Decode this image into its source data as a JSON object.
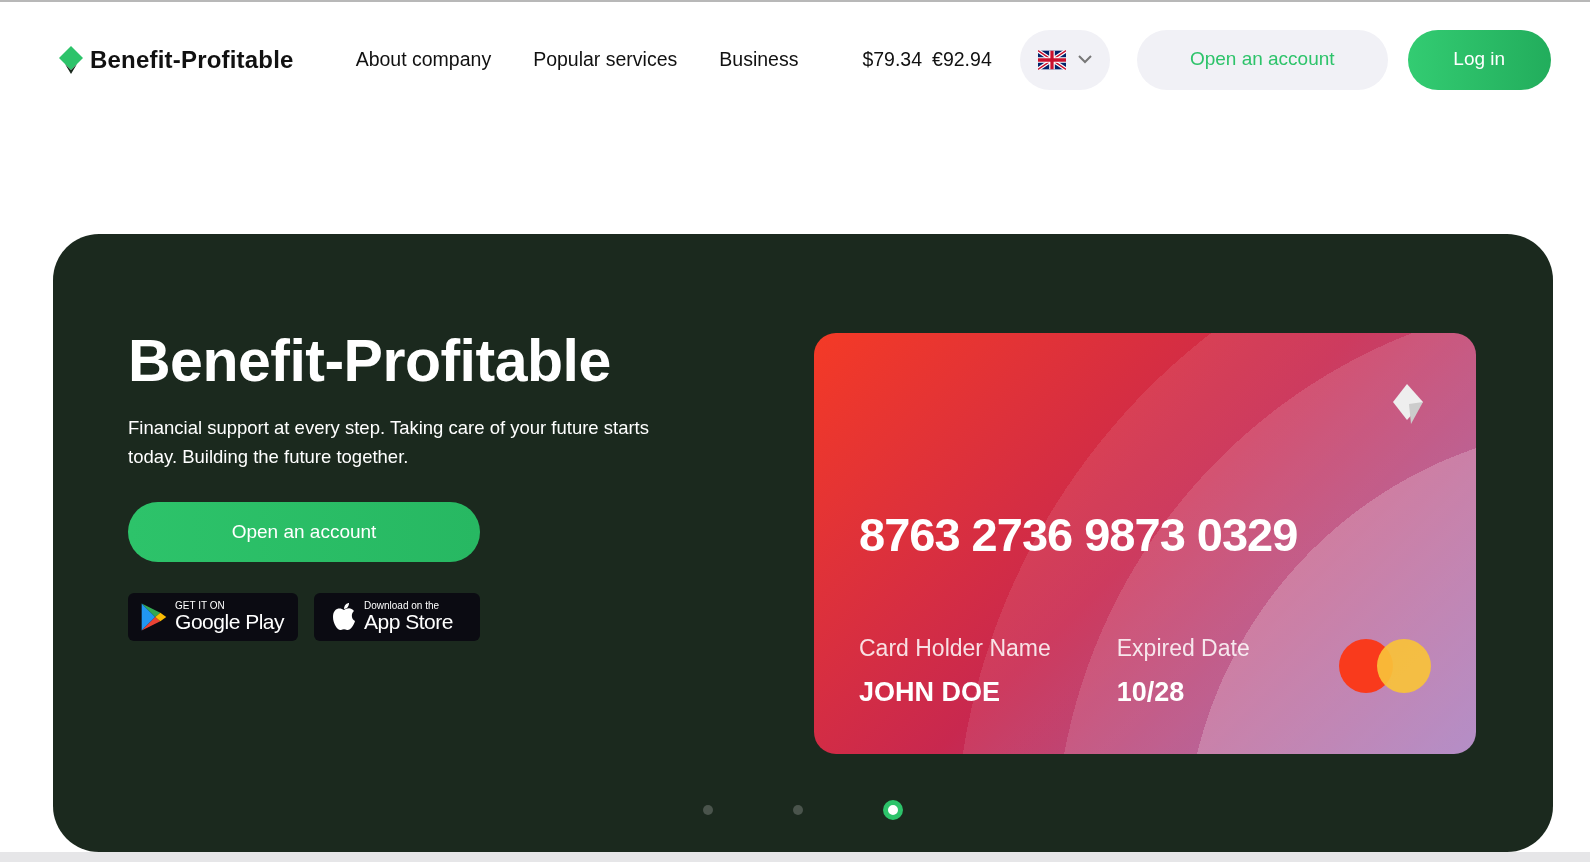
{
  "header": {
    "logo": "Benefit-Profitable",
    "nav": [
      "About company",
      "Popular services",
      "Business"
    ],
    "rates": [
      "$79.34",
      "€92.94"
    ],
    "open_account": "Open an account",
    "login": "Log in"
  },
  "hero": {
    "title": "Benefit-Profitable",
    "subtitle": "Financial support at every step. Taking care of your future starts today. Building the future together.",
    "cta": "Open an account",
    "store_badges": [
      {
        "kind": "google",
        "small": "GET IT ON",
        "big": "Google Play"
      },
      {
        "kind": "apple",
        "small": "Download on the",
        "big": "App Store"
      }
    ],
    "card": {
      "number": "8763 2736 9873 0329",
      "holder_label": "Card Holder Name",
      "holder": "JOHN DOE",
      "expiry_label": "Expired Date",
      "expiry": "10/28"
    },
    "slides": [
      {
        "selected": false
      },
      {
        "selected": false
      },
      {
        "selected": true
      }
    ]
  }
}
